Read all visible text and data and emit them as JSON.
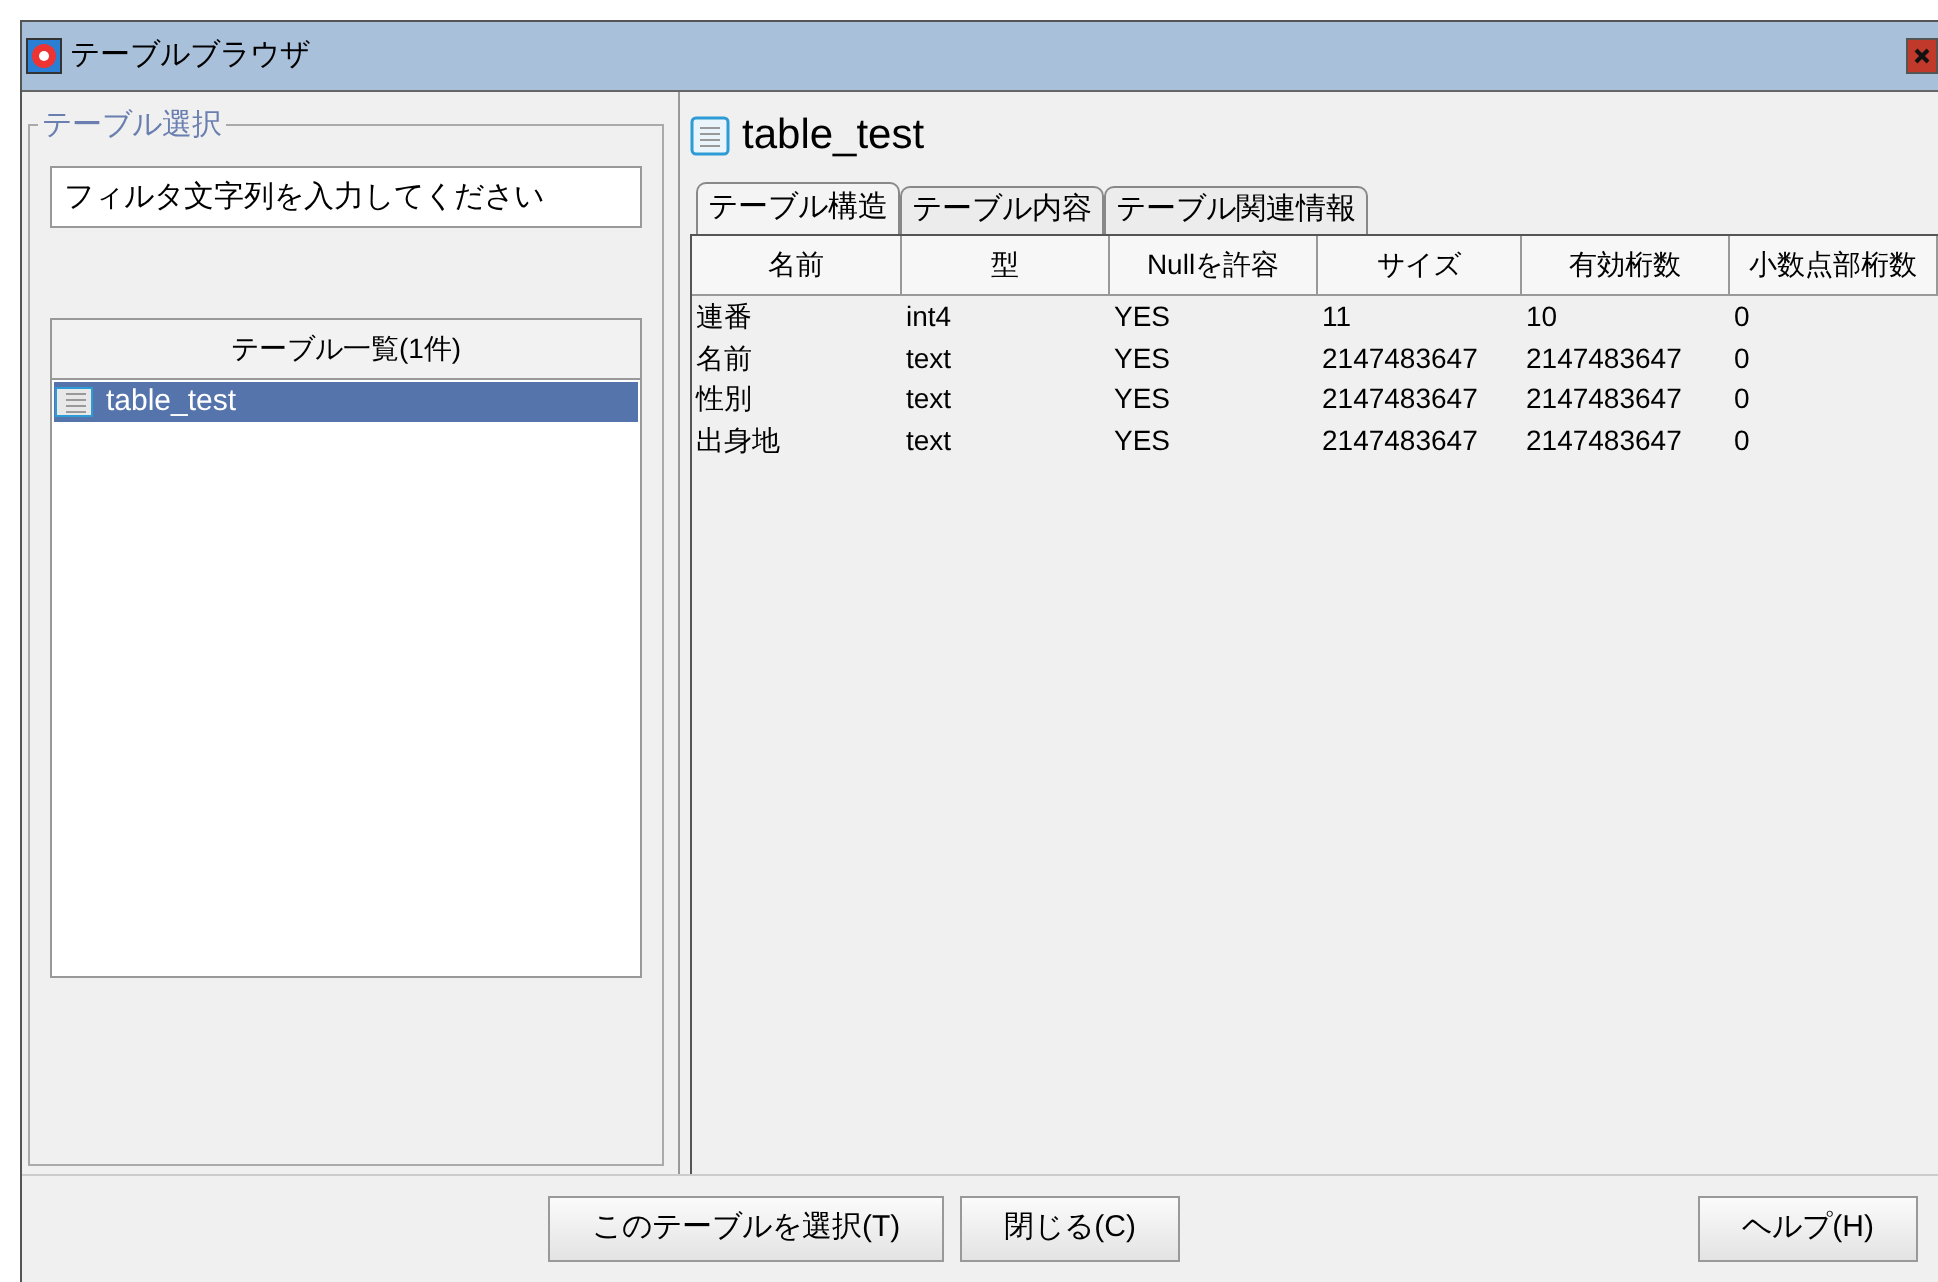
{
  "window": {
    "title": "テーブルブラウザ"
  },
  "selection_group": {
    "title": "テーブル選択",
    "filter": {
      "placeholder": "フィルタ文字列を入力してください"
    },
    "list": {
      "header": "テーブル一覧(1件)",
      "items": [
        {
          "label": "table_test",
          "selected": true
        }
      ]
    }
  },
  "detail": {
    "title": "table_test",
    "tabs": [
      {
        "label": "テーブル構造",
        "selected": true
      },
      {
        "label": "テーブル内容",
        "selected": false
      },
      {
        "label": "テーブル関連情報",
        "selected": false
      }
    ],
    "table": {
      "columns": [
        "名前",
        "型",
        "Nullを許容",
        "サイズ",
        "有効桁数",
        "小数点部桁数"
      ],
      "rows": [
        [
          "連番",
          "int4",
          "YES",
          "11",
          "10",
          "0"
        ],
        [
          "名前",
          "text",
          "YES",
          "2147483647",
          "2147483647",
          "0"
        ],
        [
          "性別",
          "text",
          "YES",
          "2147483647",
          "2147483647",
          "0"
        ],
        [
          "出身地",
          "text",
          "YES",
          "2147483647",
          "2147483647",
          "0"
        ]
      ]
    }
  },
  "buttons": [
    {
      "label": "このテーブルを選択(T)",
      "kind": "left"
    },
    {
      "label": "閉じる(C)",
      "kind": "left"
    },
    {
      "label": "ヘルプ(H)",
      "kind": "right"
    }
  ]
}
